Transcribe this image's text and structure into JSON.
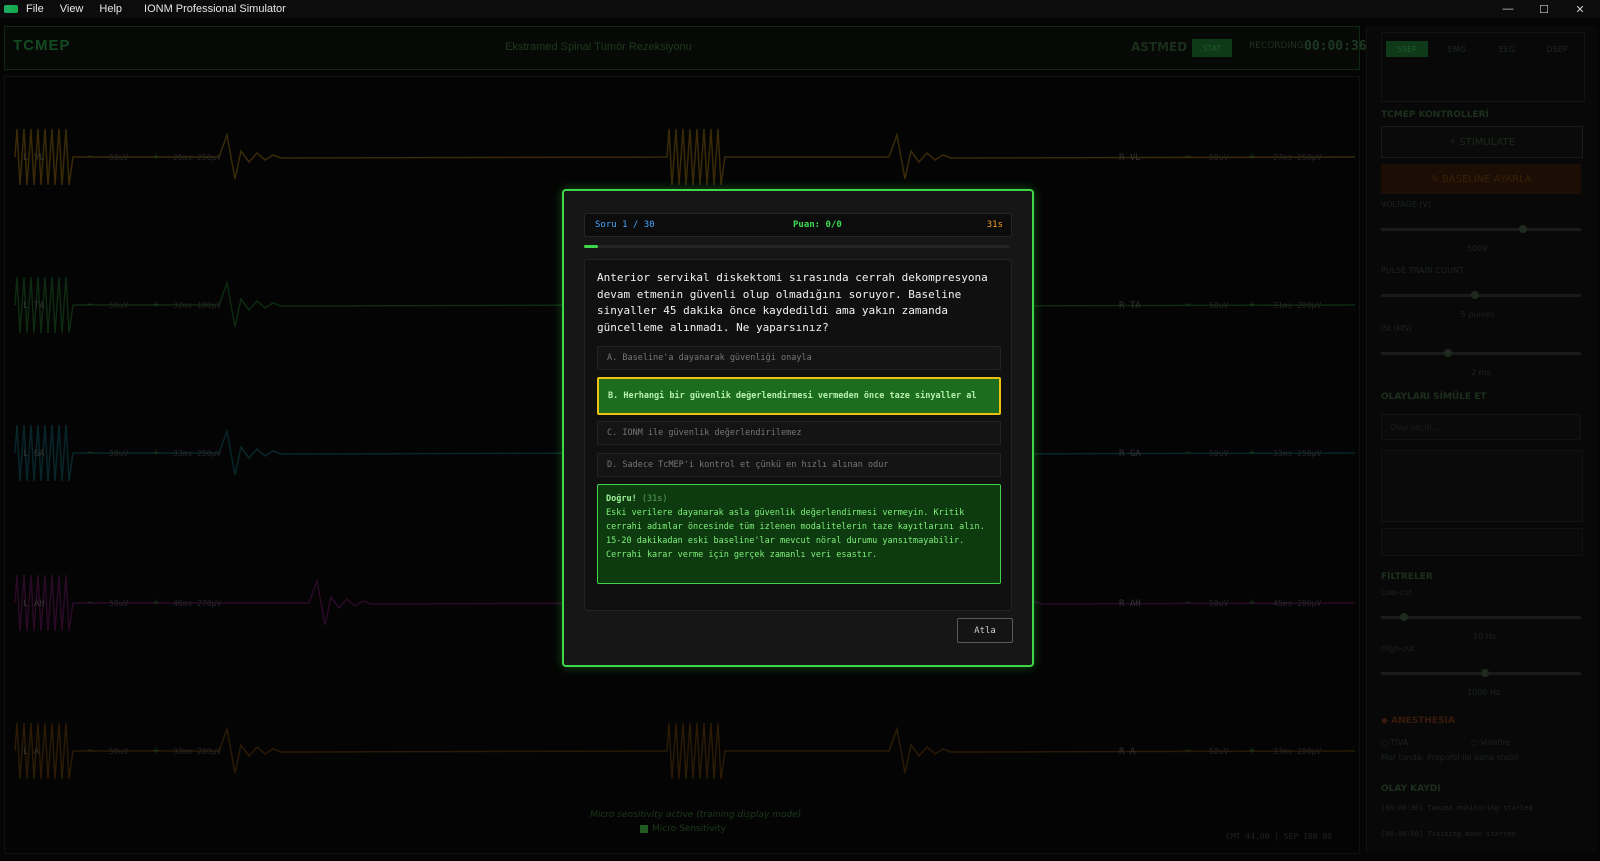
{
  "window": {
    "menu": [
      "File",
      "View",
      "Help"
    ],
    "app_title": "IONM Professional Simulator"
  },
  "header": {
    "mode": "TCMEP",
    "case_title": "Ekstramed Spinal Tümör Rezeksiyonu",
    "site": "ASTMED",
    "status": "STAT",
    "record": "RECORDING",
    "timer": "00:00:36"
  },
  "channels": [
    {
      "left": "L VL",
      "right": "R VL",
      "gain": "50uV",
      "info_left": "20ms 250µV",
      "info_right": "27ms 250µV",
      "color": "#3a2a08"
    },
    {
      "left": "L TA",
      "right": "R TA",
      "gain": "50uV",
      "info_left": "32ms 180µV",
      "info_right": "31ms 290µV",
      "color": "#0e2a10"
    },
    {
      "left": "L GA",
      "right": "R GA",
      "gain": "50uV",
      "info_left": "33ms 250µV",
      "info_right": "33ms 250µV",
      "color": "#08262a"
    },
    {
      "left": "L AH",
      "right": "R AH",
      "gain": "50uV",
      "info_left": "46ms 270µV",
      "info_right": "45ms 200µV",
      "color": "#2a0a26"
    },
    {
      "left": "L A",
      "right": "R A",
      "gain": "50uV",
      "info_left": "33ms 280µV",
      "info_right": "33ms 280µV",
      "color": "#2a1a06"
    }
  ],
  "footer": {
    "hint": "Micro sensitivity active (training display mode)",
    "micro": "Micro Sensitivity",
    "coord": "CMT 44.00 | SEP 180.00"
  },
  "right_panel": {
    "tabs": [
      "SSEP",
      "EMG",
      "EEG",
      "DSEP"
    ],
    "active_tab": "SSEP",
    "section_tcmep": "TCMEP KONTROLLERİ",
    "stimulate": "STIMULATE",
    "baseline": "BASELİNE AYARLA",
    "voltage_label": "VOLTAGE (V)",
    "voltage_value": "500V",
    "voltage_fill": 0.72,
    "pulse_label": "PULSE TRAIN COUNT",
    "pulse_value": "5 pulses",
    "pulse_fill": 0.47,
    "isi_label": "ISI (MS)",
    "isi_value": "2 ms",
    "isi_fill": 0.33,
    "events_label": "OLAYLARI SİMÜLE ET",
    "events_placeholder": "Olay seçin...",
    "filters_label": "FİLTRELER",
    "lowcut_label": "Low-cut",
    "lowcut_value": "10 Hz",
    "lowcut_fill": 0.1,
    "highcut_label": "High-cut",
    "highcut_value": "1000 Hz",
    "highcut_fill": 0.52,
    "anesthesia_label": "ANESTHESIA",
    "anesthesia_opt1": "TIVA",
    "anesthesia_opt2": "Volatile",
    "anesthesia_note": "Mor tonda: Propofol ile daha stabil",
    "log_label": "OLAY KAYDI",
    "log_lines": [
      "[00:00:36] Tanıma monitoring started",
      "[00:00:00] Training mode started"
    ]
  },
  "quiz": {
    "counter": "Soru 1 / 30",
    "score": "Puan: 0/0",
    "time": "31s",
    "progress": 0.033,
    "question": "Anterior servikal diskektomi sırasında cerrah dekompresyona devam etmenin güvenli olup olmadığını soruyor. Baseline sinyaller 45 dakika önce kaydedildi ama yakın zamanda güncelleme alınmadı. Ne yaparsınız?",
    "options": [
      "A. Baseline'a dayanarak güvenliği onayla",
      "B. Herhangi bir güvenlik değerlendirmesi vermeden önce taze sinyaller al",
      "C. IONM ile güvenlik değerlendirilemez",
      "D. Sadece TcMEP'i kontrol et çünkü en hızlı alınan odur"
    ],
    "correct_index": 1,
    "feedback_title": "Doğru!",
    "feedback_time": "(31s)",
    "feedback_text": "Eski verilere dayanarak asla güvenlik değerlendirmesi vermeyin. Kritik cerrahi adımlar öncesinde tüm izlenen modalitelerin taze kayıtlarını alın. 15-20 dakikadan eski baseline'lar mevcut nöral durumu yansıtmayabilir. Cerrahi karar verme için gerçek zamanlı veri esastır.",
    "skip": "Atla"
  }
}
